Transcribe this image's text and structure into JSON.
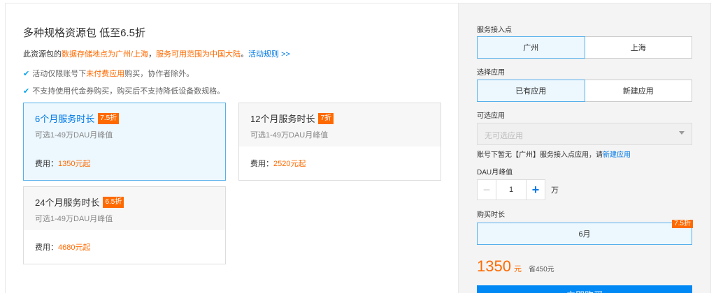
{
  "left": {
    "title": "多种规格资源包 低至6.5折",
    "desc": {
      "part1": "此资源包的",
      "part2": "数据存储地点为广州/上海",
      "part3": "，",
      "part4": "服务可用范围为中国大陆",
      "part5": "。",
      "link": "活动规则 >>"
    },
    "notes": [
      {
        "pre": "活动仅限账号下",
        "hl": "未付费应用",
        "post": "购买，协作者除外。"
      },
      {
        "pre": "不支持使用代金券购买，购买后不支持降低设备数规格。",
        "hl": "",
        "post": ""
      }
    ],
    "cards": [
      {
        "name": "6个月服务时长",
        "badge": "7.5折",
        "sub": "可选1-49万DAU月峰值",
        "fee_label": "费用：",
        "fee": "1350元起"
      },
      {
        "name": "12个月服务时长",
        "badge": "7折",
        "sub": "可选1-49万DAU月峰值",
        "fee_label": "费用：",
        "fee": "2520元起"
      },
      {
        "name": "24个月服务时长",
        "badge": "6.5折",
        "sub": "可选1-49万DAU月峰值",
        "fee_label": "费用：",
        "fee": "4680元起"
      }
    ],
    "selected_card_index": 0
  },
  "right": {
    "access_label": "服务接入点",
    "access_options": [
      "广州",
      "上海"
    ],
    "access_selected": "广州",
    "app_label": "选择应用",
    "app_options": [
      "已有应用",
      "新建应用"
    ],
    "app_selected": "已有应用",
    "available_label": "可选应用",
    "available_placeholder": "无可选应用",
    "hint_text": "账号下暂无【广州】服务接入点应用，请",
    "hint_link": "新建应用",
    "dau_label": "DAU月峰值",
    "dau_value": "1",
    "dau_unit": "万",
    "duration_label": "购买时长",
    "duration_value": "6月",
    "duration_badge": "7.5折",
    "total_amount": "1350",
    "total_currency": "元",
    "total_save": "省450元",
    "buy_label": "立即购买"
  },
  "colors": {
    "accent_orange": "#ff6a00",
    "link_blue": "#0079e6",
    "selected_bg": "#ecf7fe",
    "selected_border": "#57b0ec",
    "buy_blue": "#0088f5"
  }
}
